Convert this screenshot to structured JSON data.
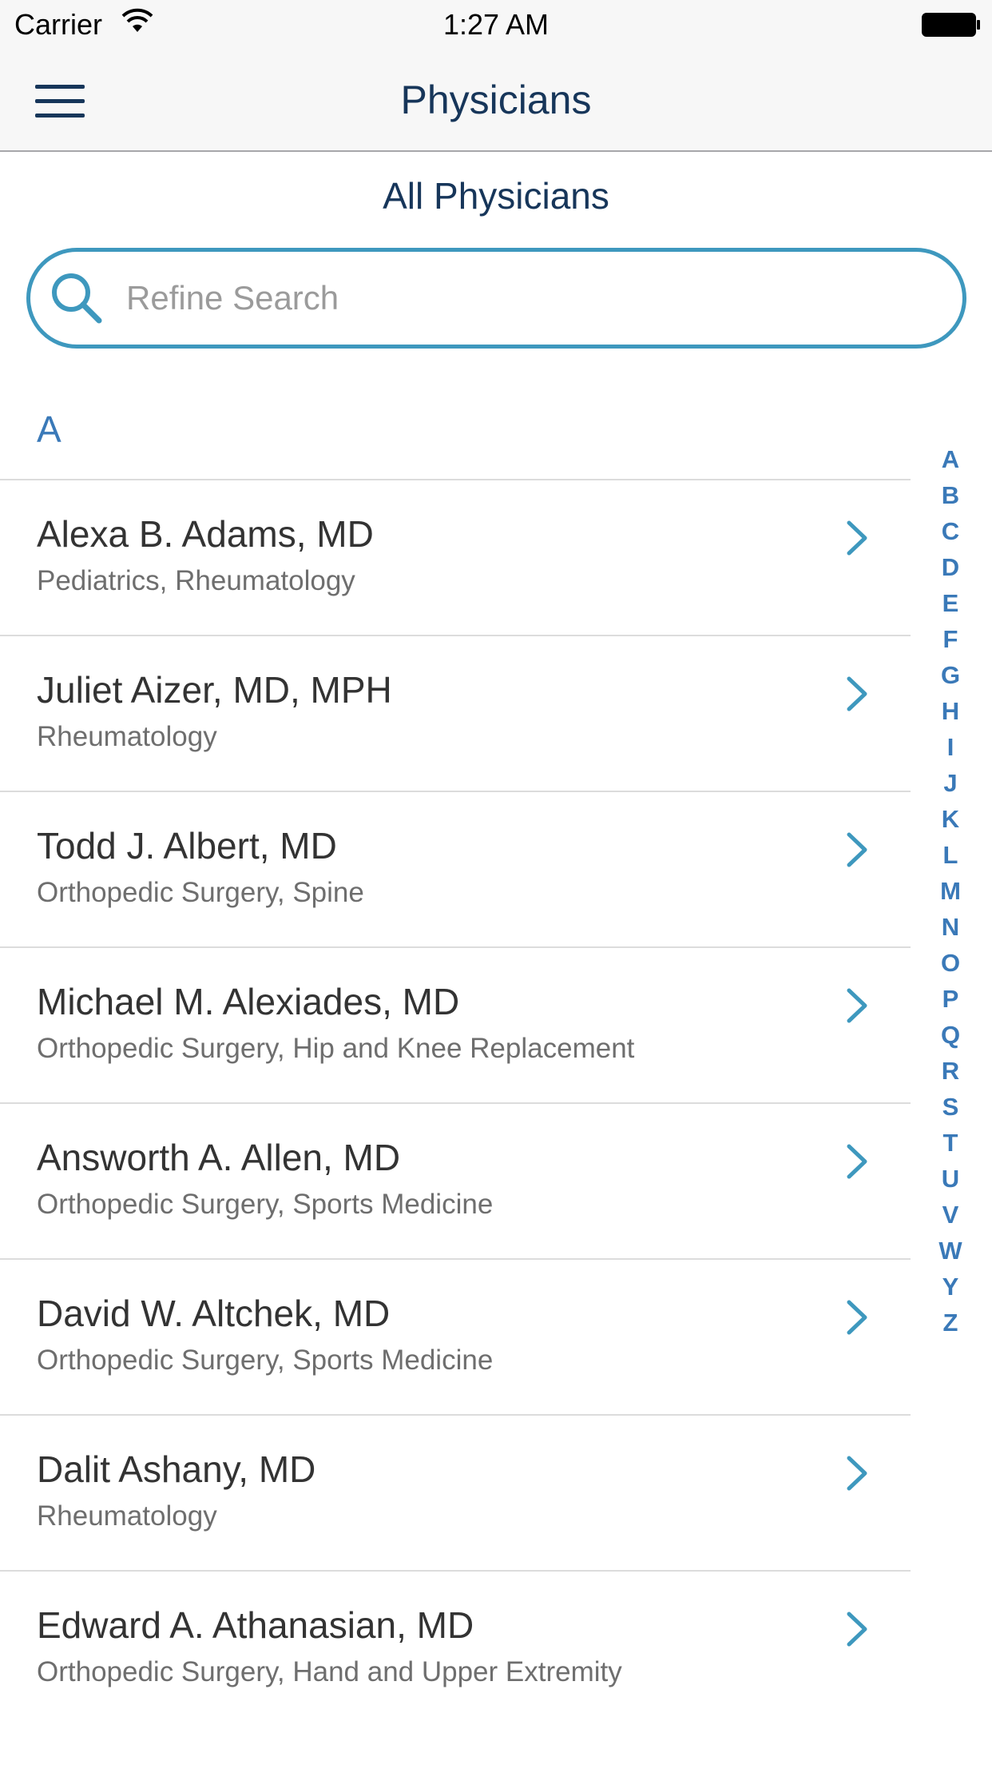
{
  "status_bar": {
    "carrier": "Carrier",
    "time": "1:27 AM",
    "wifi_icon": "wifi-icon",
    "battery_icon": "battery-icon"
  },
  "nav": {
    "menu_icon": "hamburger-menu-icon",
    "title": "Physicians"
  },
  "subtitle": "All Physicians",
  "search": {
    "placeholder": "Refine Search",
    "value": "",
    "icon": "search-icon"
  },
  "section": {
    "header": "A"
  },
  "physicians": [
    {
      "name": "Alexa B. Adams, MD",
      "specialty": "Pediatrics, Rheumatology"
    },
    {
      "name": "Juliet Aizer, MD, MPH",
      "specialty": "Rheumatology"
    },
    {
      "name": "Todd J. Albert, MD",
      "specialty": "Orthopedic Surgery, Spine"
    },
    {
      "name": "Michael M. Alexiades, MD",
      "specialty": "Orthopedic Surgery, Hip and Knee Replacement"
    },
    {
      "name": "Answorth A. Allen, MD",
      "specialty": "Orthopedic Surgery, Sports Medicine"
    },
    {
      "name": "David W. Altchek, MD",
      "specialty": "Orthopedic Surgery, Sports Medicine"
    },
    {
      "name": "Dalit Ashany, MD",
      "specialty": "Rheumatology"
    },
    {
      "name": "Edward A. Athanasian, MD",
      "specialty": "Orthopedic Surgery, Hand and Upper Extremity"
    }
  ],
  "index_letters": [
    "A",
    "B",
    "C",
    "D",
    "E",
    "F",
    "G",
    "H",
    "I",
    "J",
    "K",
    "L",
    "M",
    "N",
    "O",
    "P",
    "Q",
    "R",
    "S",
    "T",
    "U",
    "V",
    "W",
    "Y",
    "Z"
  ],
  "colors": {
    "navy": "#17365a",
    "accent": "#3e98be",
    "index_blue": "#3a79b8"
  }
}
